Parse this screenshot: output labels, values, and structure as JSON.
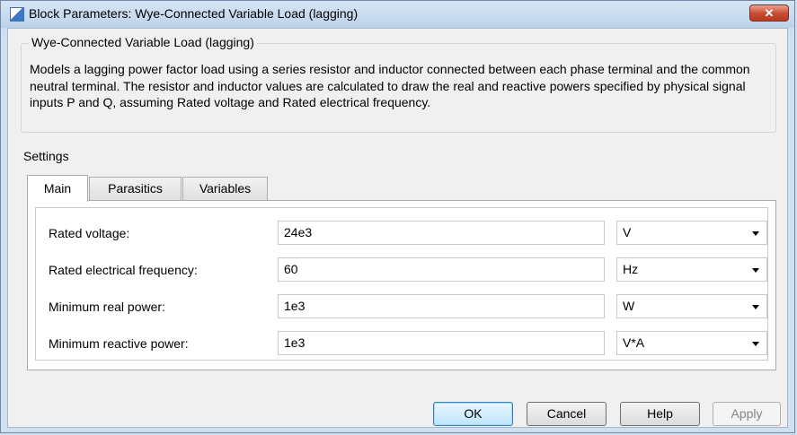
{
  "window": {
    "title": "Block Parameters: Wye-Connected Variable Load (lagging)",
    "close_label": "✕"
  },
  "block": {
    "name": "Wye-Connected Variable Load (lagging)",
    "description": "Models a lagging power factor load using a series resistor and inductor connected between each phase terminal and the common neutral terminal. The resistor and inductor values are calculated to draw the real and reactive powers specified by physical signal inputs P and Q, assuming Rated voltage and Rated electrical frequency."
  },
  "settings": {
    "legend": "Settings",
    "tabs": [
      {
        "label": "Main",
        "active": true
      },
      {
        "label": "Parasitics",
        "active": false
      },
      {
        "label": "Variables",
        "active": false
      }
    ],
    "params": [
      {
        "label": "Rated voltage:",
        "value": "24e3",
        "unit": "V"
      },
      {
        "label": "Rated electrical frequency:",
        "value": "60",
        "unit": "Hz"
      },
      {
        "label": "Minimum real power:",
        "value": "1e3",
        "unit": "W"
      },
      {
        "label": "Minimum reactive power:",
        "value": "1e3",
        "unit": "V*A"
      }
    ]
  },
  "buttons": {
    "ok": "OK",
    "cancel": "Cancel",
    "help": "Help",
    "apply": "Apply"
  },
  "colors": {
    "window_frame": "#cfe0f1",
    "close_button": "#c54a31",
    "default_button": "#bee6fd"
  }
}
